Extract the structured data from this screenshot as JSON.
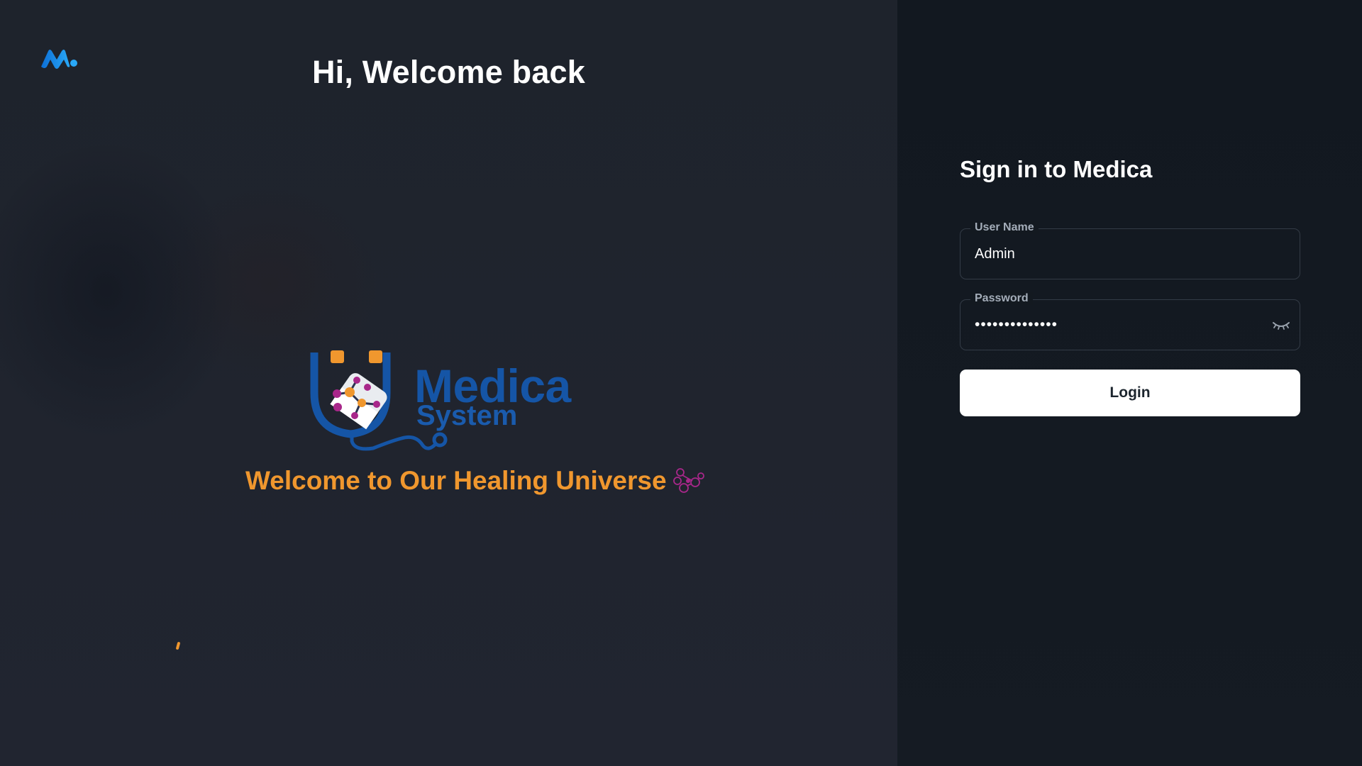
{
  "left_panel": {
    "welcome_title": "Hi, Welcome back",
    "brand_icon": "minimal-logo-icon",
    "hero": {
      "logo_icon": "stethoscope-shield-logo",
      "wordmark_primary": "Medica",
      "wordmark_secondary": "System",
      "tagline": "Welcome to Our Healing Universe",
      "tagline_icon": "molecule-icon"
    }
  },
  "signin": {
    "title": "Sign in to Medica",
    "username": {
      "label": "User Name",
      "value": "Admin"
    },
    "password": {
      "label": "Password",
      "value": "••••••••••••••",
      "toggle_icon": "eye-closed-icon"
    },
    "login_label": "Login"
  },
  "colors": {
    "left_bg": "#1f242d",
    "right_bg": "#141a22",
    "accent_orange": "#f0972e",
    "brand_blue": "#1555a6",
    "logo_cyan": "#1e9ef5",
    "magenta": "#a8278a"
  }
}
